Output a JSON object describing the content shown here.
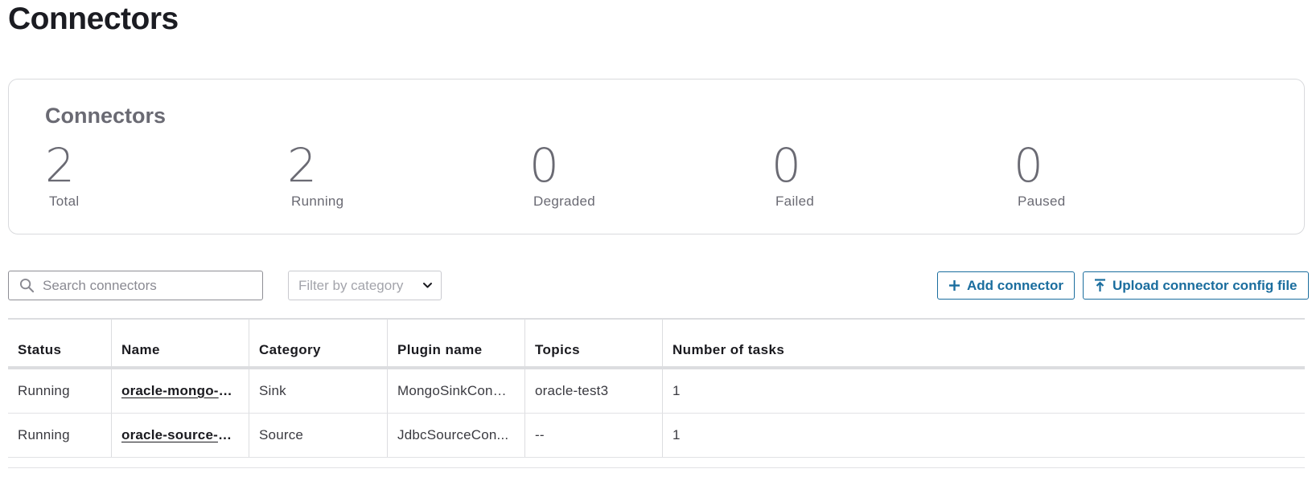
{
  "page": {
    "title": "Connectors"
  },
  "summary": {
    "title": "Connectors",
    "stats": [
      {
        "value": "2",
        "label": "Total"
      },
      {
        "value": "2",
        "label": "Running"
      },
      {
        "value": "0",
        "label": "Degraded"
      },
      {
        "value": "0",
        "label": "Failed"
      },
      {
        "value": "0",
        "label": "Paused"
      }
    ]
  },
  "toolbar": {
    "search_placeholder": "Search connectors",
    "filter_placeholder": "Filter by category",
    "add_label": "Add connector",
    "upload_label": "Upload connector config file",
    "search_icon": "search-icon",
    "add_icon": "plus-icon",
    "upload_icon": "upload-icon"
  },
  "table": {
    "columns": [
      "Status",
      "Name",
      "Category",
      "Plugin name",
      "Topics",
      "Number of tasks"
    ],
    "rows": [
      {
        "status": "Running",
        "name": "oracle-mongo-si...",
        "category": "Sink",
        "plugin": "MongoSinkConn...",
        "topics": "oracle-test3",
        "tasks": "1"
      },
      {
        "status": "Running",
        "name": "oracle-source-pr...",
        "category": "Source",
        "plugin": "JdbcSourceCon...",
        "topics": "--",
        "tasks": "1"
      }
    ]
  },
  "colors": {
    "accent": "#1a6d9e",
    "muted_text": "#6a6a73",
    "border": "#dcdde0"
  }
}
